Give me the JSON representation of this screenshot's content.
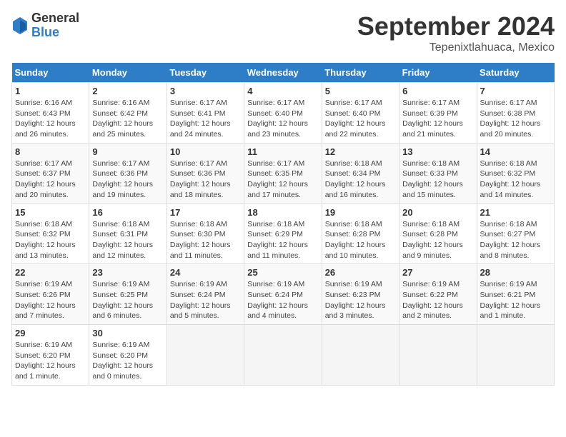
{
  "logo": {
    "general": "General",
    "blue": "Blue"
  },
  "title": "September 2024",
  "subtitle": "Tepenixtlahuaca, Mexico",
  "days_of_week": [
    "Sunday",
    "Monday",
    "Tuesday",
    "Wednesday",
    "Thursday",
    "Friday",
    "Saturday"
  ],
  "days": [
    {
      "num": "1",
      "sunrise": "6:16 AM",
      "sunset": "6:43 PM",
      "daylight": "12 hours and 26 minutes."
    },
    {
      "num": "2",
      "sunrise": "6:16 AM",
      "sunset": "6:42 PM",
      "daylight": "12 hours and 25 minutes."
    },
    {
      "num": "3",
      "sunrise": "6:17 AM",
      "sunset": "6:41 PM",
      "daylight": "12 hours and 24 minutes."
    },
    {
      "num": "4",
      "sunrise": "6:17 AM",
      "sunset": "6:40 PM",
      "daylight": "12 hours and 23 minutes."
    },
    {
      "num": "5",
      "sunrise": "6:17 AM",
      "sunset": "6:40 PM",
      "daylight": "12 hours and 22 minutes."
    },
    {
      "num": "6",
      "sunrise": "6:17 AM",
      "sunset": "6:39 PM",
      "daylight": "12 hours and 21 minutes."
    },
    {
      "num": "7",
      "sunrise": "6:17 AM",
      "sunset": "6:38 PM",
      "daylight": "12 hours and 20 minutes."
    },
    {
      "num": "8",
      "sunrise": "6:17 AM",
      "sunset": "6:37 PM",
      "daylight": "12 hours and 20 minutes."
    },
    {
      "num": "9",
      "sunrise": "6:17 AM",
      "sunset": "6:36 PM",
      "daylight": "12 hours and 19 minutes."
    },
    {
      "num": "10",
      "sunrise": "6:17 AM",
      "sunset": "6:36 PM",
      "daylight": "12 hours and 18 minutes."
    },
    {
      "num": "11",
      "sunrise": "6:17 AM",
      "sunset": "6:35 PM",
      "daylight": "12 hours and 17 minutes."
    },
    {
      "num": "12",
      "sunrise": "6:18 AM",
      "sunset": "6:34 PM",
      "daylight": "12 hours and 16 minutes."
    },
    {
      "num": "13",
      "sunrise": "6:18 AM",
      "sunset": "6:33 PM",
      "daylight": "12 hours and 15 minutes."
    },
    {
      "num": "14",
      "sunrise": "6:18 AM",
      "sunset": "6:32 PM",
      "daylight": "12 hours and 14 minutes."
    },
    {
      "num": "15",
      "sunrise": "6:18 AM",
      "sunset": "6:32 PM",
      "daylight": "12 hours and 13 minutes."
    },
    {
      "num": "16",
      "sunrise": "6:18 AM",
      "sunset": "6:31 PM",
      "daylight": "12 hours and 12 minutes."
    },
    {
      "num": "17",
      "sunrise": "6:18 AM",
      "sunset": "6:30 PM",
      "daylight": "12 hours and 11 minutes."
    },
    {
      "num": "18",
      "sunrise": "6:18 AM",
      "sunset": "6:29 PM",
      "daylight": "12 hours and 11 minutes."
    },
    {
      "num": "19",
      "sunrise": "6:18 AM",
      "sunset": "6:28 PM",
      "daylight": "12 hours and 10 minutes."
    },
    {
      "num": "20",
      "sunrise": "6:18 AM",
      "sunset": "6:28 PM",
      "daylight": "12 hours and 9 minutes."
    },
    {
      "num": "21",
      "sunrise": "6:18 AM",
      "sunset": "6:27 PM",
      "daylight": "12 hours and 8 minutes."
    },
    {
      "num": "22",
      "sunrise": "6:19 AM",
      "sunset": "6:26 PM",
      "daylight": "12 hours and 7 minutes."
    },
    {
      "num": "23",
      "sunrise": "6:19 AM",
      "sunset": "6:25 PM",
      "daylight": "12 hours and 6 minutes."
    },
    {
      "num": "24",
      "sunrise": "6:19 AM",
      "sunset": "6:24 PM",
      "daylight": "12 hours and 5 minutes."
    },
    {
      "num": "25",
      "sunrise": "6:19 AM",
      "sunset": "6:24 PM",
      "daylight": "12 hours and 4 minutes."
    },
    {
      "num": "26",
      "sunrise": "6:19 AM",
      "sunset": "6:23 PM",
      "daylight": "12 hours and 3 minutes."
    },
    {
      "num": "27",
      "sunrise": "6:19 AM",
      "sunset": "6:22 PM",
      "daylight": "12 hours and 2 minutes."
    },
    {
      "num": "28",
      "sunrise": "6:19 AM",
      "sunset": "6:21 PM",
      "daylight": "12 hours and 1 minute."
    },
    {
      "num": "29",
      "sunrise": "6:19 AM",
      "sunset": "6:20 PM",
      "daylight": "12 hours and 1 minute."
    },
    {
      "num": "30",
      "sunrise": "6:19 AM",
      "sunset": "6:20 PM",
      "daylight": "12 hours and 0 minutes."
    }
  ]
}
